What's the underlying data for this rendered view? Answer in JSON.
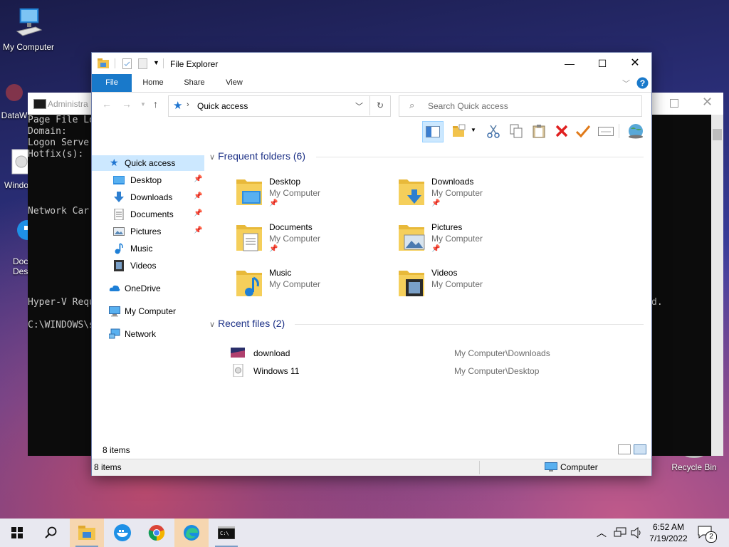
{
  "desktop": {
    "icons": [
      {
        "label": "My Computer"
      },
      {
        "label": "DataW"
      },
      {
        "label": "Windo"
      },
      {
        "label": "Doc Desk"
      },
      {
        "label": "Recycle Bin"
      }
    ]
  },
  "console": {
    "title": "Administra",
    "lines": "Page File Lo\nDomain:\nLogon Serve\nHotfix(s):\n\n\n\n\nNetwork Car\n\n\n\n\n\n\n\nHyper-V Requ\n\nC:\\WINDOWS\\s",
    "right_fragment": "d."
  },
  "explorer": {
    "title": "File Explorer",
    "tabs": {
      "file": "File",
      "home": "Home",
      "share": "Share",
      "view": "View"
    },
    "address": "Quick access",
    "search_placeholder": "Search Quick access",
    "nav": [
      {
        "label": "Quick access",
        "icon": "star-icon",
        "pinned": false
      },
      {
        "label": "Desktop",
        "icon": "desktop-folder-icon",
        "pinned": true
      },
      {
        "label": "Downloads",
        "icon": "downloads-icon",
        "pinned": true
      },
      {
        "label": "Documents",
        "icon": "documents-icon",
        "pinned": true
      },
      {
        "label": "Pictures",
        "icon": "pictures-icon",
        "pinned": true
      },
      {
        "label": "Music",
        "icon": "music-icon",
        "pinned": false
      },
      {
        "label": "Videos",
        "icon": "videos-icon",
        "pinned": false
      },
      {
        "label": "OneDrive",
        "icon": "onedrive-icon",
        "pinned": false
      },
      {
        "label": "My Computer",
        "icon": "computer-icon",
        "pinned": false
      },
      {
        "label": "Network",
        "icon": "network-icon",
        "pinned": false
      }
    ],
    "frequent_title": "Frequent folders (6)",
    "folders": [
      {
        "name": "Desktop",
        "location": "My Computer",
        "pinned": true
      },
      {
        "name": "Downloads",
        "location": "My Computer",
        "pinned": true
      },
      {
        "name": "Documents",
        "location": "My Computer",
        "pinned": true
      },
      {
        "name": "Pictures",
        "location": "My Computer",
        "pinned": true
      },
      {
        "name": "Music",
        "location": "My Computer",
        "pinned": false
      },
      {
        "name": "Videos",
        "location": "My Computer",
        "pinned": false
      }
    ],
    "recent_title": "Recent files (2)",
    "recent": [
      {
        "name": "download",
        "path": "My Computer\\Downloads"
      },
      {
        "name": "Windows 11",
        "path": "My Computer\\Desktop"
      }
    ],
    "items_count": "8 items",
    "status_left": "8 items",
    "status_right": "Computer"
  },
  "taskbar": {
    "time": "6:52 AM",
    "date": "7/19/2022",
    "notifications": "2"
  },
  "colors": {
    "accent": "#1979ca",
    "selection": "#cce8ff",
    "link_heading": "#1e3287"
  }
}
